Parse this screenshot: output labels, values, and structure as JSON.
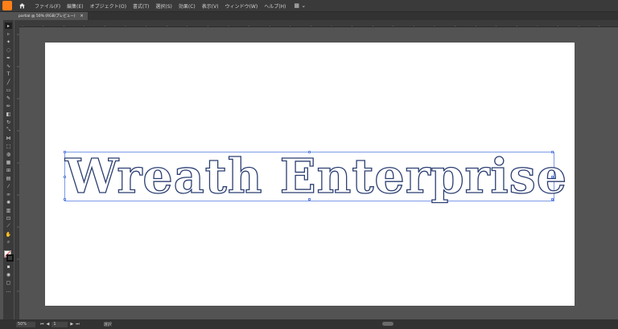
{
  "menubar": {
    "items": [
      "ファイル(F)",
      "編集(E)",
      "オブジェクト(O)",
      "書式(T)",
      "選択(S)",
      "効果(C)",
      "表示(V)",
      "ウィンドウ(W)",
      "ヘルプ(H)"
    ],
    "workspace_icon": "▦ ⌄"
  },
  "tab": {
    "title": "partial @ 50% (RGB/プレビュー)",
    "close": "×"
  },
  "ruler": {
    "ticks": [
      "150",
      "100",
      "50",
      "0",
      "50",
      "100",
      "150",
      "200",
      "250",
      "300",
      "350",
      "400",
      "450",
      "500",
      "550",
      "600",
      "650",
      "700",
      "750",
      "800",
      "850",
      "900",
      "950",
      "1000",
      "1050",
      "1100",
      "1150",
      "1200",
      "1250"
    ]
  },
  "artboard": {
    "text": "Wreath Enterprise"
  },
  "status": {
    "zoom": "50%",
    "page": "1",
    "tool": "選択"
  },
  "colors": {
    "accent": "#ff7f18",
    "selection": "#7b9ae6",
    "outline": "#2c3f72"
  }
}
